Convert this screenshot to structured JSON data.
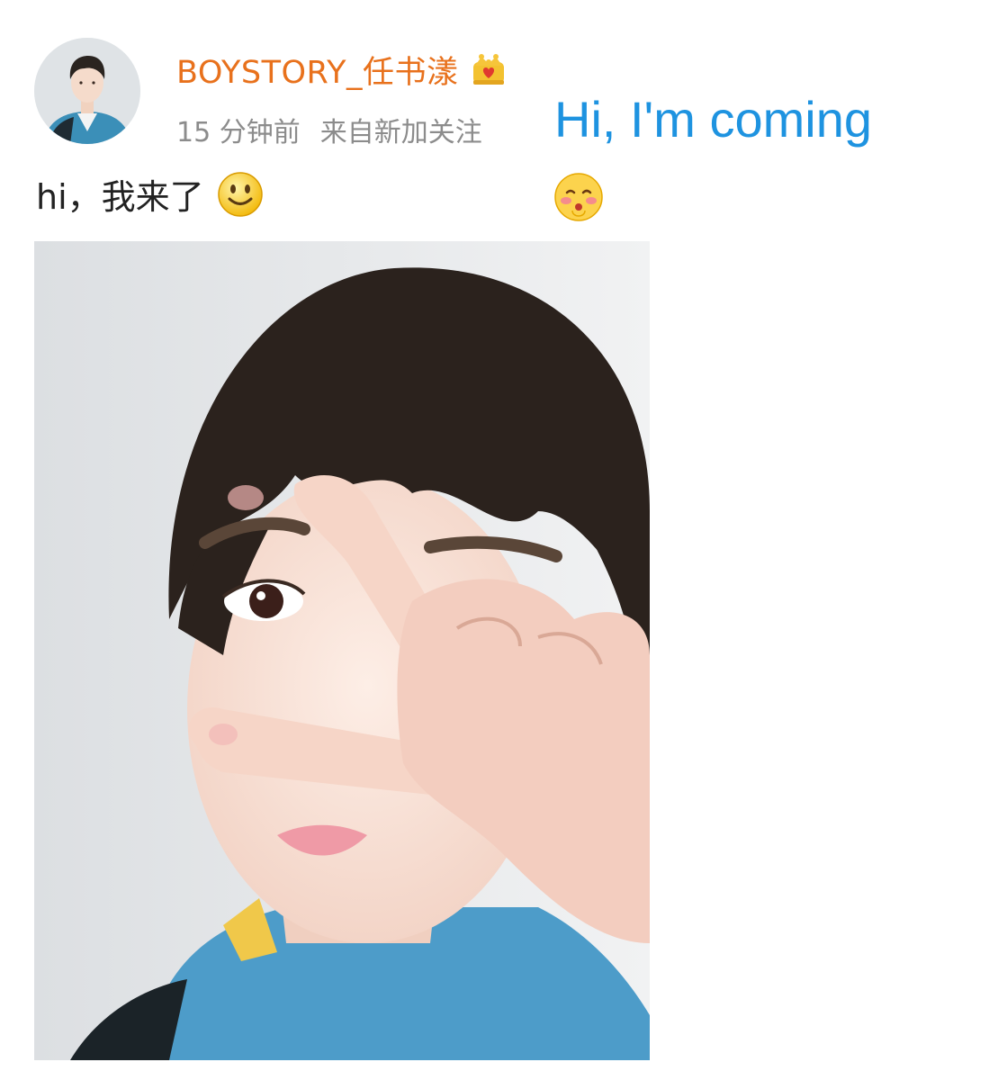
{
  "post": {
    "username": "BOYSTORY_任书漾",
    "time": "15 分钟前",
    "source": "来自新加关注",
    "text": "hi，我来了",
    "translation": "Hi, I'm coming"
  },
  "icons": {
    "avatar": "avatar-photo",
    "badge": "crown-icon",
    "text_emoji": "smile-emoji-icon",
    "caption_emoji": "blushing-emoji-icon"
  },
  "colors": {
    "username": "#e8711c",
    "meta": "#8c8c8c",
    "translation": "#1e93e0",
    "post_text": "#222222"
  }
}
